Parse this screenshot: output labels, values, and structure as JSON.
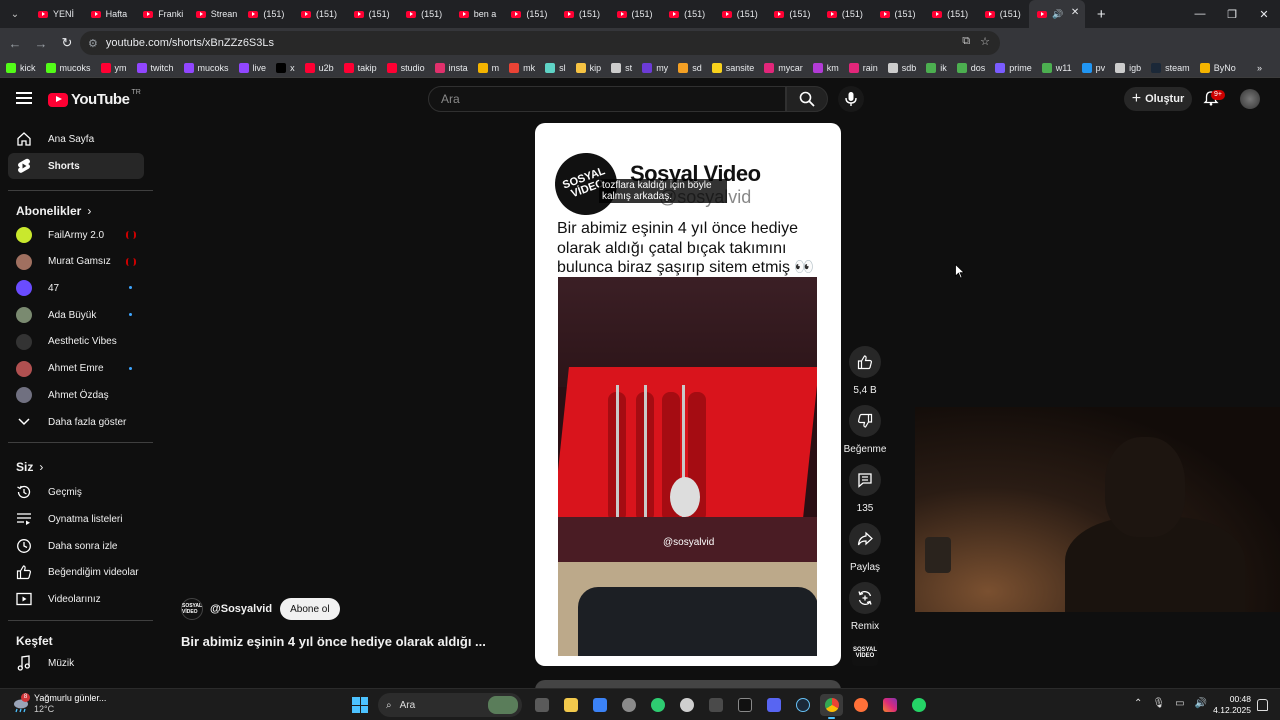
{
  "browser": {
    "tabs": [
      {
        "label": "YENİ"
      },
      {
        "label": "Hafta"
      },
      {
        "label": "Franki"
      },
      {
        "label": "Strean"
      },
      {
        "label": "(151)"
      },
      {
        "label": "(151)"
      },
      {
        "label": "(151)"
      },
      {
        "label": "(151)"
      },
      {
        "label": "ben a"
      },
      {
        "label": "(151)"
      },
      {
        "label": "(151)"
      },
      {
        "label": "(151)"
      },
      {
        "label": "(151)"
      },
      {
        "label": "(151)"
      },
      {
        "label": "(151)"
      },
      {
        "label": "(151)"
      },
      {
        "label": "(151)"
      },
      {
        "label": "(151)"
      },
      {
        "label": "(151)"
      },
      {
        "label": "(151)"
      }
    ],
    "active_tab_close": "✕",
    "new_tab": "+",
    "url": "youtube.com/shorts/xBnZZz6S3Ls",
    "bookmarks": [
      {
        "label": "kick",
        "color": "#53fc18"
      },
      {
        "label": "mucoks",
        "color": "#53fc18"
      },
      {
        "label": "ym",
        "color": "#ff0033"
      },
      {
        "label": "twitch",
        "color": "#9146ff"
      },
      {
        "label": "mucoks",
        "color": "#9146ff"
      },
      {
        "label": "live",
        "color": "#9146ff"
      },
      {
        "label": "x",
        "color": "#000000"
      },
      {
        "label": "u2b",
        "color": "#ff0033"
      },
      {
        "label": "takip",
        "color": "#ff0033"
      },
      {
        "label": "studio",
        "color": "#ff0033"
      },
      {
        "label": "insta",
        "color": "#e1306c"
      },
      {
        "label": "m",
        "color": "#f4b400"
      },
      {
        "label": "mk",
        "color": "#ea4335"
      },
      {
        "label": "sl",
        "color": "#5fd3c6"
      },
      {
        "label": "kip",
        "color": "#f6c343"
      },
      {
        "label": "st",
        "color": "#cccccc"
      },
      {
        "label": "my",
        "color": "#6c3bd6"
      },
      {
        "label": "sd",
        "color": "#f4a024"
      },
      {
        "label": "sansite",
        "color": "#f8d21c"
      },
      {
        "label": "mycar",
        "color": "#e2267a"
      },
      {
        "label": "km",
        "color": "#b23bd6"
      },
      {
        "label": "rain",
        "color": "#e2267a"
      },
      {
        "label": "sdb",
        "color": "#cccccc"
      },
      {
        "label": "ik",
        "color": "#4caf50"
      },
      {
        "label": "dos",
        "color": "#4caf50"
      },
      {
        "label": "prime",
        "color": "#7a5cff"
      },
      {
        "label": "w11",
        "color": "#4caf50"
      },
      {
        "label": "pv",
        "color": "#2196f3"
      },
      {
        "label": "igb",
        "color": "#cccccc"
      },
      {
        "label": "steam",
        "color": "#1b2838"
      },
      {
        "label": "ByNo",
        "color": "#f4b400"
      }
    ]
  },
  "youtube": {
    "logo_text": "YouTube",
    "logo_region": "TR",
    "search_placeholder": "Ara",
    "create_label": "Oluştur",
    "notifications_badge": "9+",
    "sidebar": {
      "home": "Ana Sayfa",
      "shorts": "Shorts",
      "subscriptions_header": "Abonelikler",
      "subscriptions": [
        {
          "name": "FailArmy 2.0",
          "indicator": "live",
          "color": "#c9e82d"
        },
        {
          "name": "Murat Gamsız",
          "indicator": "live",
          "color": "#a07060"
        },
        {
          "name": "47",
          "indicator": "new",
          "color": "#6a4cff"
        },
        {
          "name": "Ada Büyük",
          "indicator": "new",
          "color": "#7a8a70"
        },
        {
          "name": "Aesthetic Vibes",
          "indicator": "none",
          "color": "#333333"
        },
        {
          "name": "Ahmet Emre",
          "indicator": "new",
          "color": "#b05050"
        },
        {
          "name": "Ahmet Özdaş",
          "indicator": "none",
          "color": "#707080"
        }
      ],
      "show_more": "Daha fazla göster",
      "you_header": "Siz",
      "you_items": [
        "Geçmiş",
        "Oynatma listeleri",
        "Daha sonra izle",
        "Beğendiğim videolar",
        "Videolarınız"
      ],
      "explore_header": "Keşfet",
      "explore_items": [
        "Müzik"
      ]
    },
    "short": {
      "brand_title": "Sosyal Video",
      "brand_logo_text": "SOSYAL VİDEO",
      "brand_handle": "@sosyalvid",
      "caption_overlay": "tozflara kaldığı için böyle kalmış arkadaş.",
      "headline": "Bir abimiz eşinin 4 yıl önce hediye olarak aldığı çatal bıçak takımını bulunca biraz şaşırıp sitem etmiş 👀",
      "watermark": "@sosyalvid",
      "channel": "@Sosyalvid",
      "subscribe": "Abone ol",
      "title": "Bir abimiz eşinin 4 yıl önce hediye olarak aldığı ..."
    },
    "actions": {
      "like_count": "5,4 B",
      "dislike": "Beğenme",
      "comments": "135",
      "share": "Paylaş",
      "remix": "Remix"
    }
  },
  "taskbar": {
    "weather_title": "Yağmurlu günler...",
    "weather_temp": "12°C",
    "weather_badge": "8",
    "search": "Ara",
    "time": "00:48",
    "date": "4.12.2025"
  }
}
